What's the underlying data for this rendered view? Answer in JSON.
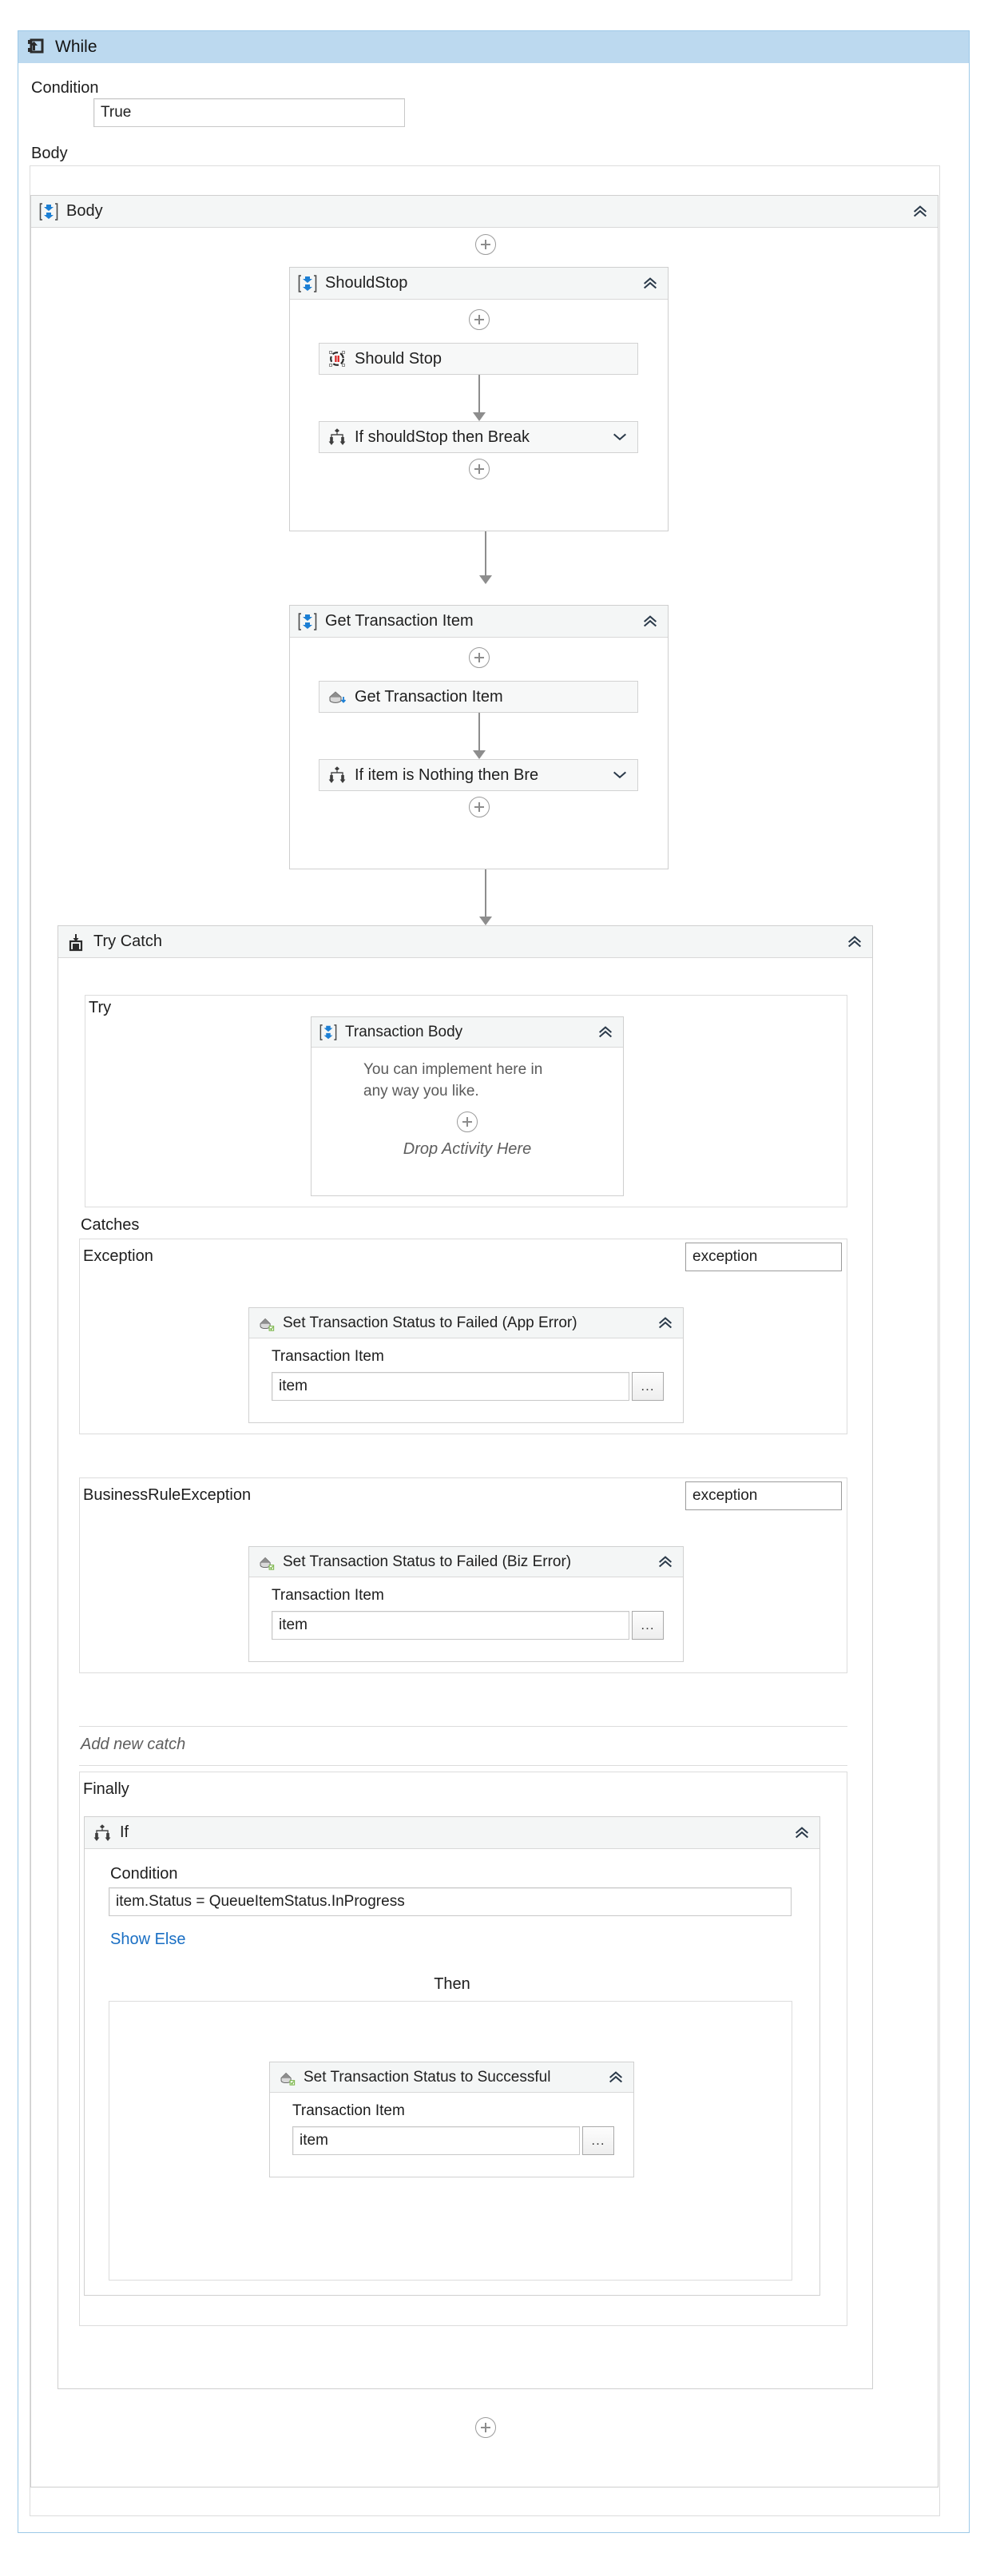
{
  "root": {
    "title": "While",
    "icon": "while-loop-icon",
    "condition_label": "Condition",
    "condition_value": "True",
    "body_label": "Body"
  },
  "body_sequence": {
    "title": "Body",
    "icon": "sequence-icon"
  },
  "should_stop_sequence": {
    "title": "ShouldStop",
    "icon": "sequence-icon",
    "activity": {
      "title": "Should Stop",
      "icon": "should-stop-icon"
    },
    "if_activity": {
      "title": "If shouldStop then Break",
      "icon": "flow-decision-icon"
    }
  },
  "get_transaction_sequence": {
    "title": "Get Transaction Item",
    "icon": "sequence-icon",
    "activity": {
      "title": "Get Transaction Item",
      "icon": "queue-get-icon"
    },
    "if_activity": {
      "title": "If item is Nothing then Bre",
      "icon": "flow-decision-icon"
    }
  },
  "try_catch": {
    "title": "Try Catch",
    "icon": "try-catch-icon",
    "try_label": "Try",
    "transaction_body": {
      "title": "Transaction Body",
      "icon": "sequence-icon",
      "hint_line1": "You can implement here in",
      "hint_line2": "any way you like.",
      "drop_text": "Drop Activity Here"
    },
    "catches_label": "Catches",
    "catches": [
      {
        "exception_type": "Exception",
        "exception_var": "exception",
        "activity": {
          "title": "Set Transaction Status to Failed (App Error)",
          "icon": "set-transaction-status-icon",
          "field_label": "Transaction Item",
          "field_value": "item",
          "browse_label": "..."
        }
      },
      {
        "exception_type": "BusinessRuleException",
        "exception_var": "exception",
        "activity": {
          "title": "Set Transaction Status to Failed (Biz Error)",
          "icon": "set-transaction-status-icon",
          "field_label": "Transaction Item",
          "field_value": "item",
          "browse_label": "..."
        }
      }
    ],
    "add_new_catch": "Add new catch",
    "finally_label": "Finally",
    "finally_if": {
      "title": "If",
      "icon": "flow-decision-icon",
      "condition_label": "Condition",
      "condition_value": "item.Status = QueueItemStatus.InProgress",
      "show_else": "Show Else",
      "then_label": "Then",
      "then_activity": {
        "title": "Set Transaction Status to Successful",
        "icon": "set-transaction-status-icon",
        "field_label": "Transaction Item",
        "field_value": "item",
        "browse_label": "..."
      }
    }
  },
  "colors": {
    "while_header": "#bcd9ef",
    "while_border": "#9dc9e8",
    "activity_header": "#f4f6f6",
    "border": "#d0d0d0",
    "link": "#1a6fc4",
    "icon_blue": "#1c7fd4",
    "icon_red": "#d81e1e",
    "chevron": "#2b3a4a"
  }
}
